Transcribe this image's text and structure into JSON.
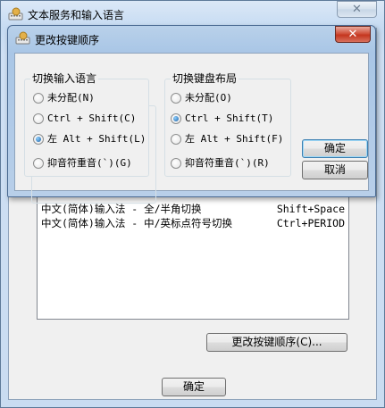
{
  "parent_window": {
    "title": "文本服务和输入语言",
    "close_symbol": "✕",
    "icon": "keyboard-globe-icon",
    "hotkeys": [
      {
        "name": "中文(简体)输入法 - 全/半角切换",
        "keys": "Shift+Space"
      },
      {
        "name": "中文(简体)输入法 - 中/英标点符号切换",
        "keys": "Ctrl+PERIOD"
      }
    ],
    "change_sequence_label": "更改按键顺序(C)...",
    "ok_label": "确定"
  },
  "dialog": {
    "title": "更改按键顺序",
    "close_symbol": "✕",
    "icon": "keyboard-globe-icon",
    "input_language": {
      "title": "切换输入语言",
      "options": [
        "未分配(N)",
        "Ctrl + Shift(C)",
        "左 Alt + Shift(L)",
        "抑音符重音(`)(G)"
      ],
      "selected_index": 2
    },
    "keyboard_layout": {
      "title": "切换键盘布局",
      "options": [
        "未分配(O)",
        "Ctrl + Shift(T)",
        "左 Alt + Shift(F)",
        "抑音符重音(`)(R)"
      ],
      "selected_index": 1
    },
    "ok_label": "确定",
    "cancel_label": "取消"
  },
  "colors": {
    "title_bar": "#c6dbf2",
    "close_button": "#c4361f",
    "radio_selected": "#1b5fa3",
    "default_button_border": "#3c7fb1"
  }
}
